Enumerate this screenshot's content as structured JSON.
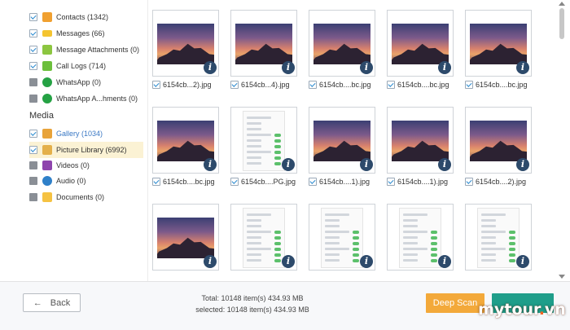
{
  "sidebar": {
    "items": [
      {
        "label": "Contacts (1342)",
        "checked": true,
        "icon": "contacts-icon",
        "color": "#f0a030"
      },
      {
        "label": "Messages (66)",
        "checked": true,
        "icon": "messages-icon",
        "color": "#f4c430"
      },
      {
        "label": "Message Attachments (0)",
        "checked": true,
        "icon": "attachment-icon",
        "color": "#8cc640"
      },
      {
        "label": "Call Logs (714)",
        "checked": true,
        "icon": "call-log-icon",
        "color": "#6cbf3c"
      },
      {
        "label": "WhatsApp (0)",
        "checked": false,
        "icon": "whatsapp-icon",
        "color": "#25a244"
      },
      {
        "label": "WhatsApp A...hments (0)",
        "checked": false,
        "icon": "whatsapp-attachment-icon",
        "color": "#25a244"
      }
    ],
    "media_title": "Media",
    "media_items": [
      {
        "label": "Gallery (1034)",
        "checked": true,
        "icon": "gallery-icon",
        "color": "#e8a33a"
      },
      {
        "label": "Picture Library (6992)",
        "checked": true,
        "icon": "picture-library-icon",
        "color": "#e4b04a"
      },
      {
        "label": "Videos (0)",
        "checked": false,
        "icon": "video-icon",
        "color": "#8e44ad"
      },
      {
        "label": "Audio (0)",
        "checked": false,
        "icon": "audio-icon",
        "color": "#2f80c9"
      },
      {
        "label": "Documents (0)",
        "checked": false,
        "icon": "folder-icon",
        "color": "#f5c242"
      }
    ]
  },
  "grid": {
    "rows": [
      [
        "6154cb...2).jpg",
        "6154cb...4).jpg",
        "6154cb....bc.jpg",
        "6154cb....bc.jpg",
        "6154cb....bc.jpg"
      ],
      [
        "6154cb....bc.jpg",
        "6154cb....PG.jpg",
        "6154cb....1).jpg",
        "6154cb....1).jpg",
        "6154cb....2).jpg"
      ]
    ]
  },
  "footer": {
    "back_label": "Back",
    "total_text": "Total: 10148 item(s) 434.93 MB",
    "selected_text": "selected: 10148 item(s) 434.93 MB",
    "deep_scan_label": "Deep Scan"
  },
  "watermark": {
    "brand": "mytour",
    "dot": ".",
    "tld": "vn"
  }
}
